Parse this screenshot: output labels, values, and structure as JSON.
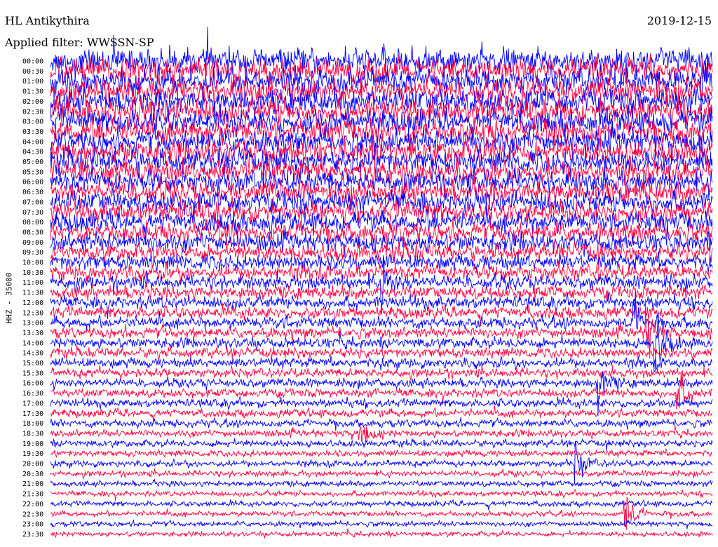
{
  "header": {
    "station": "HL Antikythira",
    "date": "2019-12-15",
    "filter": "Applied filter: WWSSN-SP"
  },
  "chart_data": {
    "type": "line",
    "title": "HL Antikythira",
    "subtitle": "Applied filter: WWSSN-SP",
    "date": "2019-12-15",
    "ylabel": "HHZ - 35000",
    "xlabel": "",
    "grid": false,
    "legend": "none",
    "colors": [
      "#0000ff",
      "#ff0040"
    ],
    "y_ticks": [
      "00:00",
      "00:30",
      "01:00",
      "01:30",
      "02:00",
      "02:30",
      "03:00",
      "03:30",
      "04:00",
      "04:30",
      "05:00",
      "05:30",
      "06:00",
      "06:30",
      "07:00",
      "07:30",
      "08:00",
      "08:30",
      "09:00",
      "09:30",
      "10:00",
      "10:30",
      "11:00",
      "11:30",
      "12:00",
      "12:30",
      "13:00",
      "13:30",
      "14:00",
      "14:30",
      "15:00",
      "15:30",
      "16:00",
      "16:30",
      "17:00",
      "17:30",
      "18:00",
      "18:30",
      "19:00",
      "19:30",
      "20:00",
      "20:30",
      "21:00",
      "21:30",
      "22:00",
      "22:30",
      "23:00",
      "23:30"
    ],
    "x_range_minutes": [
      0,
      30
    ],
    "noise_amplitude": [
      9.5,
      9.5,
      9.2,
      9.0,
      9.0,
      9.0,
      8.8,
      8.8,
      8.6,
      8.6,
      8.4,
      8.3,
      8.1,
      8.0,
      7.8,
      7.6,
      7.3,
      7.0,
      6.6,
      6.2,
      5.8,
      5.5,
      5.2,
      4.9,
      4.6,
      4.4,
      4.2,
      4.0,
      3.9,
      3.7,
      3.6,
      3.4,
      3.3,
      3.2,
      3.1,
      2.9,
      2.8,
      2.6,
      2.5,
      2.4,
      2.3,
      2.2,
      2.1,
      2.0,
      2.0,
      1.9,
      1.9,
      1.8
    ],
    "events": [
      {
        "trace": 2,
        "minute": 29.5,
        "amplitude": 30
      },
      {
        "trace": 22,
        "minute": 15.0,
        "amplitude": 20
      },
      {
        "trace": 26,
        "minute": 26.4,
        "amplitude": 20
      },
      {
        "trace": 27,
        "minute": 27.0,
        "amplitude": 25
      },
      {
        "trace": 28,
        "minute": 27.4,
        "amplitude": 30
      },
      {
        "trace": 32,
        "minute": 24.8,
        "amplitude": 20
      },
      {
        "trace": 33,
        "minute": 28.4,
        "amplitude": 18
      },
      {
        "trace": 37,
        "minute": 14.0,
        "amplitude": 14
      },
      {
        "trace": 40,
        "minute": 23.8,
        "amplitude": 16
      },
      {
        "trace": 45,
        "minute": 26.0,
        "amplitude": 24
      }
    ]
  }
}
